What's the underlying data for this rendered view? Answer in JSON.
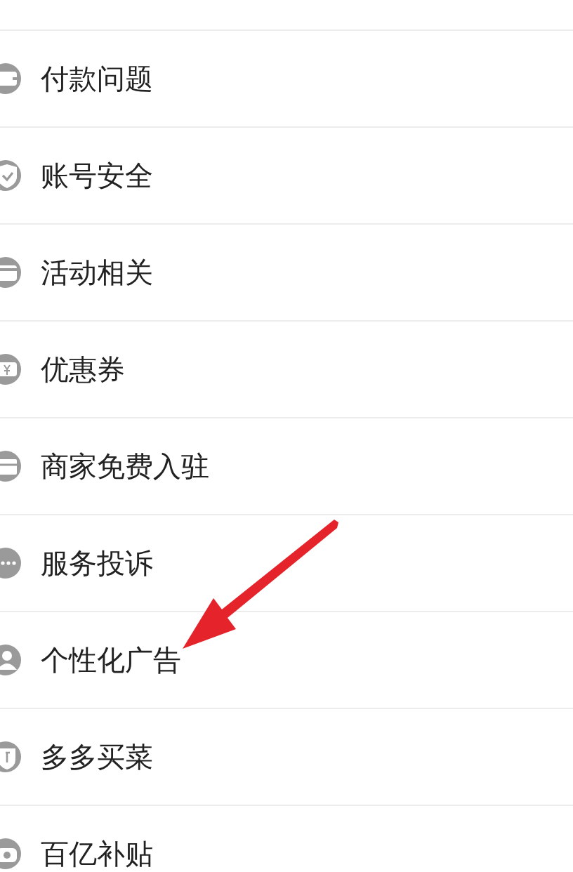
{
  "menu": {
    "items": [
      {
        "label": "付款问题"
      },
      {
        "label": "账号安全"
      },
      {
        "label": "活动相关"
      },
      {
        "label": "优惠券"
      },
      {
        "label": "商家免费入驻"
      },
      {
        "label": "服务投诉"
      },
      {
        "label": "个性化广告"
      },
      {
        "label": "多多买菜"
      },
      {
        "label": "百亿补贴"
      }
    ]
  }
}
